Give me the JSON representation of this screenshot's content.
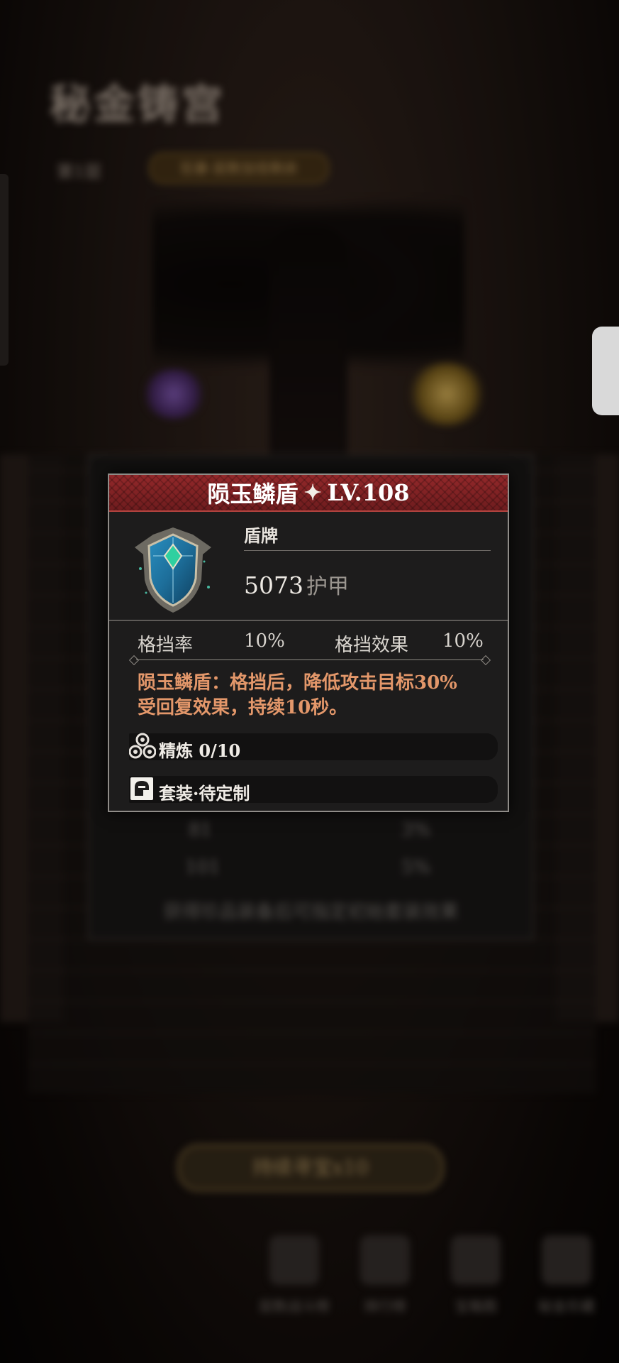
{
  "background": {
    "title": "秘金铸宫",
    "floor_label": "第1层",
    "event_label": "狂暴·层数加倍剩余",
    "under_rows": [
      {
        "level": "81",
        "value": "3%"
      },
      {
        "level": "101",
        "value": "5%"
      }
    ],
    "under_note": "获得珍品装备后可指定初始套装效果",
    "continue_button": "持续寻宝x10",
    "nav": [
      "层数战斗榜",
      "排行榜",
      "宝箱图",
      "秘金珍藏"
    ]
  },
  "item": {
    "name": "陨玉鳞盾",
    "level": "LV.108",
    "type": "盾牌",
    "main_stat_value": "5073",
    "main_stat_unit": "护甲",
    "stats": [
      {
        "label": "格挡率",
        "value": "10%"
      },
      {
        "label": "格挡效果",
        "value": "10%"
      }
    ],
    "description_line1": "陨玉鳞盾：格挡后，降低攻击目标30%",
    "description_line2": "受回复效果，持续10秒。",
    "refine_label": "精炼 0/10",
    "set_label": "套装·待定制"
  },
  "colors": {
    "header_red": "#7f2022",
    "description_orange": "#e3976a",
    "panel_bg": "#1d1c1c"
  },
  "icons": {
    "shield": "shield-icon",
    "star": "sparkle-star-icon",
    "refine": "refine-cluster-icon",
    "set": "set-helmet-icon"
  }
}
